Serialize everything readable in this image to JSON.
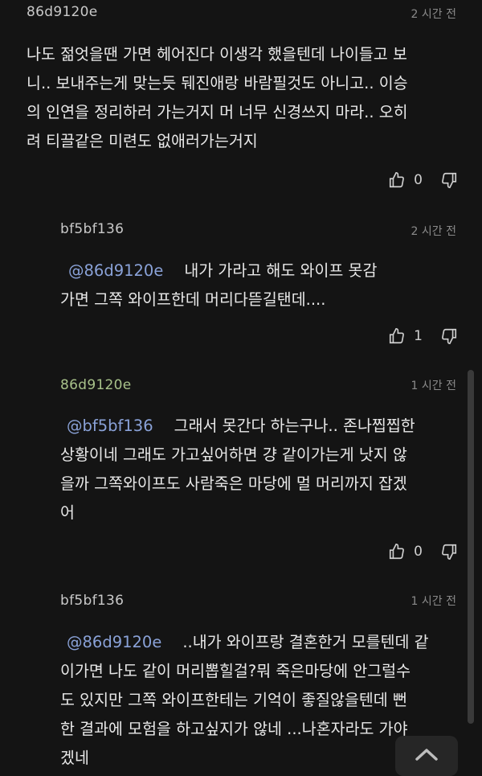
{
  "comments": [
    {
      "author": "86d9120e",
      "time": "2 시간 전",
      "lines": [
        "나도 젊엇을땐 가면 헤어진다 이생각 했을텐데 나이들고 보",
        "니.. 보내주는게 맞는듯 뒈진애랑 바람필것도 아니고.. 이승",
        "의 인연을 정리하러 가는거지 머 너무 신경쓰지 마라.. 오히",
        "려 티끌같은 미련도 없애러가는거지"
      ],
      "likes": "0"
    },
    {
      "author": "bf5bf136",
      "time": "2 시간 전",
      "mention": "@86d9120e",
      "lines": [
        "내가 가라고 해도 와이프 못감",
        "가면 그쪽 와이프한데 머리다뜯길탠데...."
      ],
      "likes": "1"
    },
    {
      "author": "86d9120e",
      "time": "1 시간 전",
      "mention": "@bf5bf136",
      "lines": [
        "그래서 못간다 하는구나.. 존나찝찝한",
        "상황이네 그래도 가고싶어하면 걍 같이가는게 낫지 않",
        "을까 그쪽와이프도 사람죽은 마당에 멀 머리까지 잡겠",
        "어"
      ],
      "likes": "0"
    },
    {
      "author": "bf5bf136",
      "time": "1 시간 전",
      "mention": "@86d9120e",
      "lines": [
        "..내가 와이프랑 결혼한거 모를텐데 같",
        "이가면 나도 같이 머리뽑힐걸?뭐 죽은마당에 안그럴수",
        "도 있지만 그쪽 와이프한테는 기억이 좋질않을텐데 뻔",
        "한 결과에 모험을 하고싶지가 않네 ...나혼자라도 가야",
        "겠네"
      ]
    }
  ],
  "colors": {
    "author_primary": "#c9c9c9",
    "author_green": "#a8c28a",
    "mention": "#8aa2d8",
    "background": "#141414"
  },
  "icons": {
    "like": "thumbs-up-icon",
    "dislike": "thumbs-down-icon",
    "scroll_top": "chevron-up-icon"
  }
}
